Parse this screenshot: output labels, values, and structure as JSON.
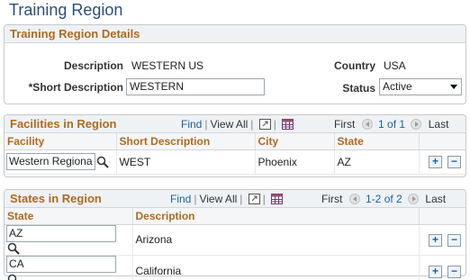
{
  "page": {
    "title": "Training Region"
  },
  "details": {
    "title": "Training Region Details",
    "description_label": "Description",
    "description_value": "WESTERN US",
    "country_label": "Country",
    "country_value": "USA",
    "short_description_label": "*Short Description",
    "short_description_value": "WESTERN",
    "status_label": "Status",
    "status_value": "Active"
  },
  "facilities": {
    "title": "Facilities in Region",
    "nav": {
      "find": "Find",
      "view_all": "View All",
      "first": "First",
      "range": "1 of 1",
      "last": "Last"
    },
    "columns": [
      "Facility",
      "Short Description",
      "City",
      "State"
    ],
    "rows": [
      {
        "facility": "Western Regiona",
        "short_description": "WEST",
        "city": "Phoenix",
        "state": "AZ"
      }
    ]
  },
  "states": {
    "title": "States in Region",
    "nav": {
      "find": "Find",
      "view_all": "View All",
      "first": "First",
      "range": "1-2 of 2",
      "last": "Last"
    },
    "columns": [
      "State",
      "Description"
    ],
    "rows": [
      {
        "state": "AZ",
        "description": "Arizona"
      },
      {
        "state": "CA",
        "description": "California"
      }
    ]
  },
  "buttons": {
    "add": "+",
    "delete": "−"
  },
  "colors": {
    "title": "#2b4e78",
    "group_title": "#b06a1e",
    "link": "#1d5fa0"
  }
}
